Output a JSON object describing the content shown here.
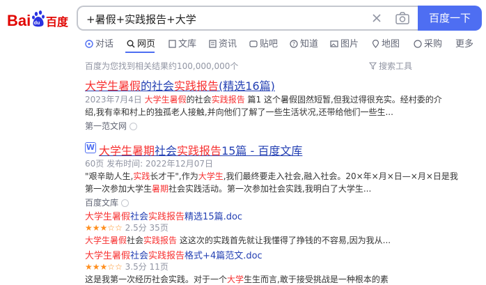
{
  "logo": {
    "text1": "Bai",
    "text2": "百度"
  },
  "search": {
    "query": "+暑假+实践报告+大学",
    "button_label": "百度一下"
  },
  "tabs": [
    {
      "label": "对话"
    },
    {
      "label": "网页"
    },
    {
      "label": "文库"
    },
    {
      "label": "资讯"
    },
    {
      "label": "贴吧"
    },
    {
      "label": "知道"
    },
    {
      "label": "图片"
    },
    {
      "label": "地图"
    },
    {
      "label": "采购"
    },
    {
      "label": "更多"
    }
  ],
  "meta": {
    "result_count": "百度为您找到相关结果约100,000,000个",
    "tools_label": "搜索工具"
  },
  "result1": {
    "title_a": "大学生暑假",
    "title_b": "的社会",
    "title_c": "实践报告",
    "title_d": "(精选16篇)",
    "date": "2023年7月4日",
    "line1_a": "大学生",
    "line1_b": "暑假",
    "line1_c": "的社会",
    "line1_d": "实践报告",
    "line1_e": " 篇1 这个暑假固然短暂,但我过得很充实。经村委的介",
    "line2": "绍,我有幸和村上的独孤老人接触,并向他们了解了一些生活状况,还带给他们一些生...",
    "source": "第一范文网"
  },
  "result2": {
    "title_a": "大学生",
    "title_b": "暑期",
    "title_c": "社会",
    "title_d": "实践报告",
    "title_e": "15篇 - 百度文库",
    "meta": "60页  发布时间: 2022年12月07日",
    "line1_a": "\"艰辛助人生,",
    "line1_b": "实践",
    "line1_c": "长才干\",作为",
    "line1_d": "大学生",
    "line1_e": ",我们最终要走入社会,融入社会。20×年×月×日—×月×日是我",
    "line2_a": "第一次参加大学生",
    "line2_b": "暑期",
    "line2_c": "社会实践活动。第一次参加社会实践,我明白了大学生...",
    "source": "百度文库",
    "sub1": {
      "title_a": "大学生暑假",
      "title_b": "社会",
      "title_c": "实践报告",
      "title_d": "精选15篇.doc",
      "rating": "2.5分",
      "pages": "35页",
      "desc_a": "大学生暑假",
      "desc_b": "社会",
      "desc_c": "实践报告",
      "desc_d": " 这这次的实践首先就让我懂得了挣钱的不容易,因为我从..."
    },
    "sub2": {
      "title_a": "大学生暑假",
      "title_b": "社会",
      "title_c": "实践报告",
      "title_d": "格式+4篇范文.doc",
      "rating": "3.5分",
      "pages": "11页",
      "desc_a": "这是我第一次经历社会实践。对于一个",
      "desc_b": "大学",
      "desc_c": "生生而言,敢于接受挑战是一种根本的素"
    }
  },
  "colors": {
    "accent": "#4e6ef2",
    "link": "#2440b3",
    "highlight": "#f73131",
    "star": "#ff8f1f"
  }
}
